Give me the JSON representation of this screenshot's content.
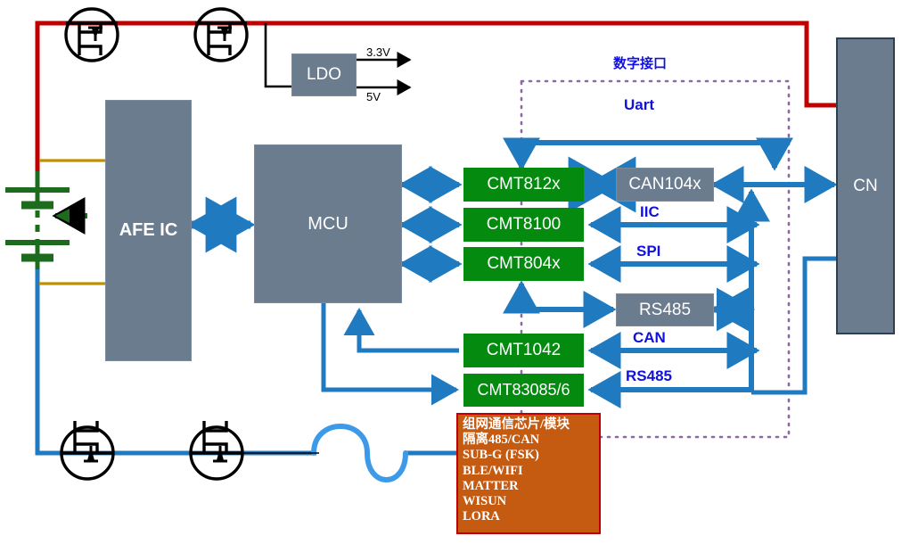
{
  "diagram": {
    "title_cn": "数字接口",
    "blocks": {
      "ldo": "LDO",
      "afe": "AFE IC",
      "mcu": "MCU",
      "cn": "CN",
      "can104x": "CAN104x",
      "rs485_block": "RS485",
      "cmt812x": "CMT812x",
      "cmt8100": "CMT8100",
      "cmt804x": "CMT804x",
      "cmt1042": "CMT1042",
      "cmt83085": "CMT83085/6"
    },
    "bus_labels": {
      "uart": "Uart",
      "iic": "IIC",
      "spi": "SPI",
      "can": "CAN",
      "rs485": "RS485"
    },
    "rails": {
      "v33": "3.3V",
      "v5": "5V"
    },
    "module_box": {
      "lines": [
        "组网通信芯片/模块",
        "隔离485/CAN",
        "SUB-G (FSK)",
        "BLE/WIFI",
        "MATTER",
        "WISUN",
        "LORA"
      ]
    },
    "icons": {
      "mosfet_hs1": "mosfet-icon",
      "mosfet_hs2": "mosfet-icon",
      "mosfet_ls1": "mosfet-icon",
      "mosfet_ls2": "mosfet-icon",
      "battery": "battery-stack-icon",
      "inductor": "inductor-coil-icon"
    },
    "colors": {
      "power_red": "#c00000",
      "power_blue": "#1f7ac0",
      "signal_blue": "#1f7ac0",
      "sense_olive": "#bf9000",
      "battery_green": "#1d6b1d",
      "block_green": "#038a0f",
      "block_gray": "#6b7c8f",
      "module_orange": "#c55a11",
      "label_blue": "#1111dd",
      "boundary_purple": "#8b6aa0",
      "coil_blue": "#3d9ae8"
    }
  }
}
